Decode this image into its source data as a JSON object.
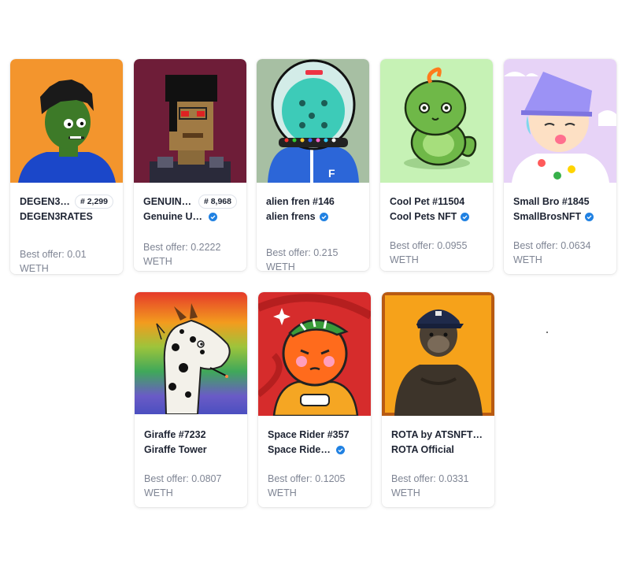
{
  "nfts": [
    {
      "name": "DEGEN3RA...",
      "rank": "# 2,299",
      "collection": "DEGEN3RATES",
      "verified": false,
      "offer": "Best offer: 0.01 WETH"
    },
    {
      "name": "GENUINE ...",
      "rank": "# 8,968",
      "collection": "Genuine Und...",
      "verified": true,
      "offer": "Best offer: 0.2222 WETH"
    },
    {
      "name": "alien fren #146",
      "collection": "alien frens",
      "verified": true,
      "offer": "Best offer: 0.215 WETH"
    },
    {
      "name": "Cool Pet #11504",
      "collection": "Cool Pets NFT",
      "verified": true,
      "offer": "Best offer: 0.0955 WETH"
    },
    {
      "name": "Small Bro #1845",
      "collection": "SmallBrosNFT",
      "verified": true,
      "offer": "Best offer: 0.0634 WETH"
    },
    {
      "name": "Giraffe #7232",
      "collection": "Giraffe Tower",
      "verified": false,
      "offer": "Best offer: 0.0807 WETH"
    },
    {
      "name": "Space Rider #357",
      "collection": "Space Riders ...",
      "verified": true,
      "offer": "Best offer: 0.1205 WETH"
    },
    {
      "name": "ROTA by ATSNFT #5...",
      "collection": "ROTA Official",
      "verified": false,
      "offer": "Best offer: 0.0331 WETH"
    }
  ],
  "colors": {
    "accent_verified": "#2081e2",
    "muted_text": "#7f8594"
  },
  "icons": {
    "verified": "verified-check-icon"
  }
}
